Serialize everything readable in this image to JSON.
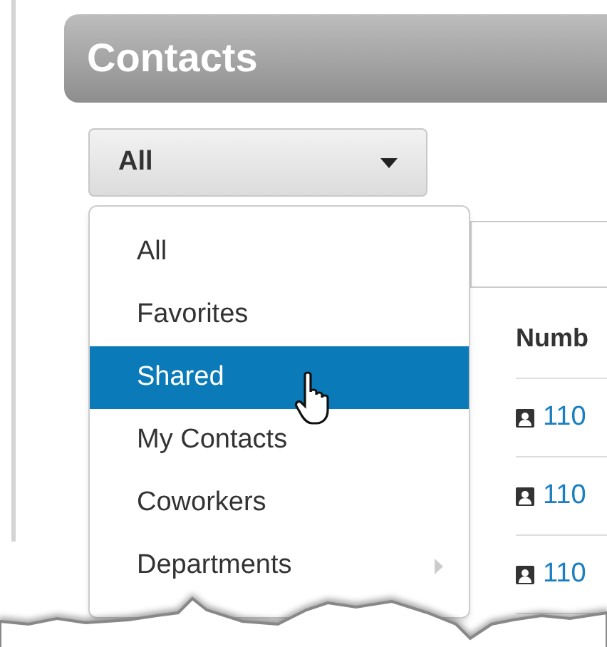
{
  "header": {
    "title": "Contacts"
  },
  "filter": {
    "value": "All"
  },
  "menu": {
    "items": [
      {
        "label": "All",
        "selected": false,
        "submenu": false
      },
      {
        "label": "Favorites",
        "selected": false,
        "submenu": false
      },
      {
        "label": "Shared",
        "selected": true,
        "submenu": false
      },
      {
        "label": "My Contacts",
        "selected": false,
        "submenu": false
      },
      {
        "label": "Coworkers",
        "selected": false,
        "submenu": false
      },
      {
        "label": "Departments",
        "selected": false,
        "submenu": true
      }
    ]
  },
  "table": {
    "columns": [
      "Numb"
    ],
    "rows": [
      {
        "number": "110"
      },
      {
        "number": "110"
      },
      {
        "number": "110"
      }
    ]
  }
}
